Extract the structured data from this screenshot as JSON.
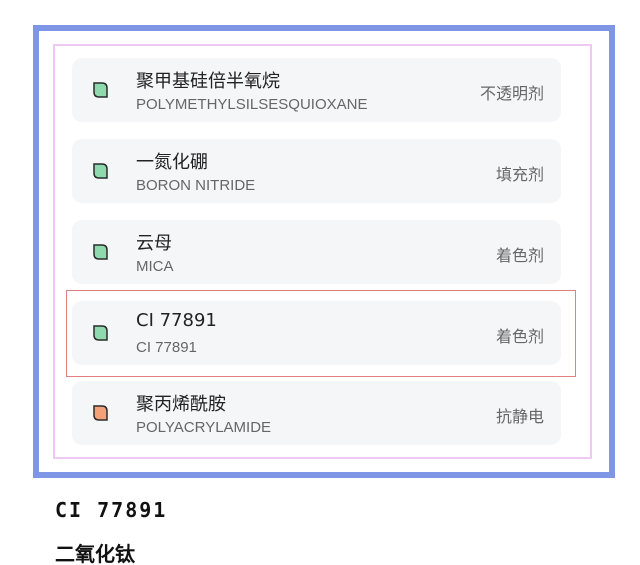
{
  "ingredients": [
    {
      "name_zh": "聚甲基硅倍半氧烷",
      "name_en": "POLYMETHYLSILSESQUIOXANE",
      "function": "不透明剂",
      "leaf_color": "#8fd9ae"
    },
    {
      "name_zh": "一氮化硼",
      "name_en": "BORON NITRIDE",
      "function": "填充剂",
      "leaf_color": "#8fd9ae"
    },
    {
      "name_zh": "云母",
      "name_en": "MICA",
      "function": "着色剂",
      "leaf_color": "#8fd9ae"
    },
    {
      "name_zh": "CI 77891",
      "name_en": "CI 77891",
      "function": "着色剂",
      "leaf_color": "#8fd9ae"
    },
    {
      "name_zh": "聚丙烯酰胺",
      "name_en": "POLYACRYLAMIDE",
      "function": "抗静电",
      "leaf_color": "#f4a078"
    }
  ],
  "caption": {
    "code": "CI 77891",
    "chemical": "二氧化钛"
  },
  "colors": {
    "outer_border": "#7f96e7",
    "inner_border": "#efc9f1",
    "highlight_border": "#e08080",
    "card_bg": "#f5f6f8"
  }
}
